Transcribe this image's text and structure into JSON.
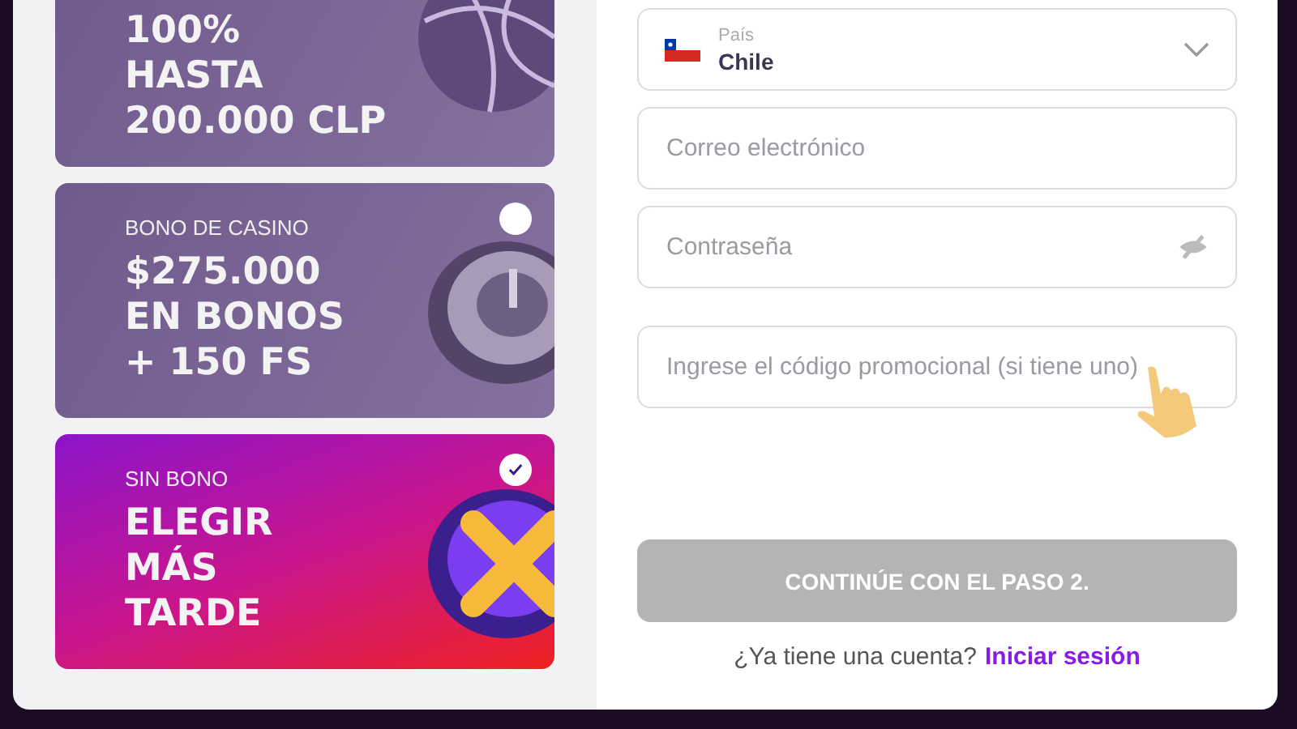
{
  "bonus_cards": [
    {
      "kind": "sports",
      "title": "100%\nHASTA\n200.000 CLP"
    },
    {
      "kind": "casino",
      "selected": false,
      "label": "BONO DE CASINO",
      "title": "$275.000\nEN BONOS\n+ 150 FS"
    },
    {
      "kind": "none",
      "selected": true,
      "label": "SIN BONO",
      "title": "ELEGIR\nMÁS\nTARDE"
    }
  ],
  "country_field": {
    "label": "País",
    "value": "Chile"
  },
  "email_field": {
    "placeholder": "Correo electrónico"
  },
  "password_field": {
    "placeholder": "Contraseña"
  },
  "promo_field": {
    "placeholder": "Ingrese el código promocional (si tiene uno)"
  },
  "continue_button": {
    "label": "CONTINÚE CON EL PASO 2.",
    "disabled": true
  },
  "login_prompt": {
    "text": "¿Ya tiene una cuenta?",
    "link": "Iniciar sesión"
  }
}
